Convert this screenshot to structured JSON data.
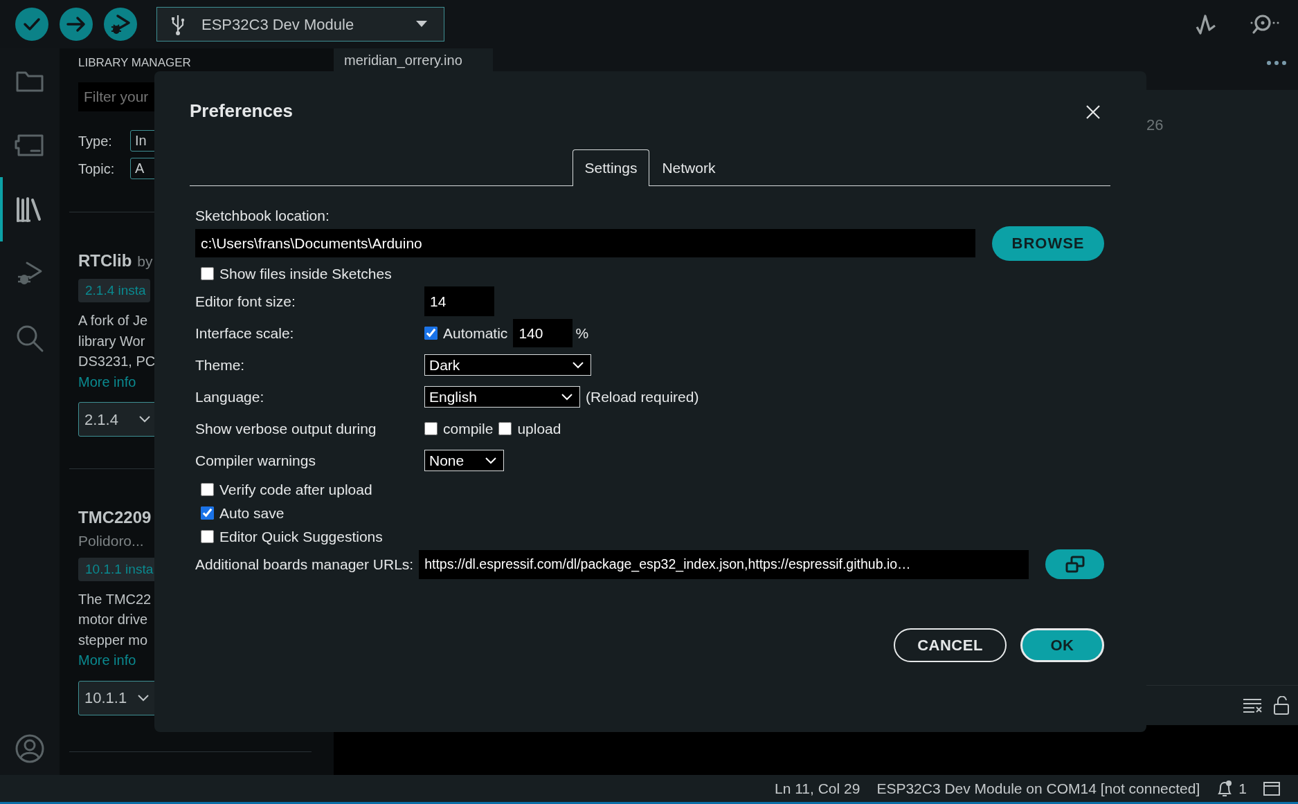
{
  "toolbar": {
    "board": "ESP32C3 Dev Module"
  },
  "activity_bar": [
    {
      "kind": "folder",
      "selected": false
    },
    {
      "kind": "board",
      "selected": false
    },
    {
      "kind": "library",
      "selected": true
    },
    {
      "kind": "debug",
      "selected": false
    },
    {
      "kind": "search",
      "selected": false
    }
  ],
  "library_manager": {
    "title": "LIBRARY MANAGER",
    "filter": {
      "placeholder": "Filter your"
    },
    "filters": [
      {
        "label": "Type:",
        "value": "In"
      },
      {
        "label": "Topic:",
        "value": "A"
      }
    ],
    "libraries": [
      {
        "name": "RTClib",
        "author": "by",
        "installed": "2.1.4 insta",
        "description": [
          "A fork of Je",
          "library Wor",
          "DS3231, PC"
        ],
        "link": "More info",
        "version": "2.1.4"
      },
      {
        "name": "TMC2209",
        "author": "Polidoro...",
        "installed": "10.1.1 insta",
        "description": [
          "The TMC22",
          "motor drive",
          "stepper mo"
        ],
        "link": "More info",
        "version": "10.1.1"
      }
    ]
  },
  "editor": {
    "tab": "meridian_orrery.ino",
    "line_number": "26"
  },
  "dialog": {
    "title": "Preferences",
    "tabs": [
      {
        "label": "Settings",
        "selected": true
      },
      {
        "label": "Network",
        "selected": false
      }
    ],
    "sketchbook": {
      "label": "Sketchbook location:",
      "value": "c:\\Users\\frans\\Documents\\Arduino",
      "button": "BROWSE"
    },
    "show_files": {
      "label": "Show files inside Sketches",
      "checked": false
    },
    "font_size": {
      "label": "Editor font size:",
      "value": "14"
    },
    "interface_scale": {
      "label": "Interface scale:",
      "automatic": {
        "label": "Automatic",
        "checked": true
      },
      "value": "140",
      "unit": "%"
    },
    "theme": {
      "label": "Theme:",
      "value": "Dark"
    },
    "language": {
      "label": "Language:",
      "value": "English",
      "note": "(Reload required)"
    },
    "verbose": {
      "label": "Show verbose output during",
      "options": [
        {
          "label": "compile",
          "checked": false
        },
        {
          "label": "upload",
          "checked": false
        }
      ]
    },
    "compiler_warnings": {
      "label": "Compiler warnings",
      "value": "None"
    },
    "options": [
      {
        "label": "Verify code after upload",
        "checked": false
      },
      {
        "label": "Auto save",
        "checked": true
      },
      {
        "label": "Editor Quick Suggestions",
        "checked": false
      }
    ],
    "boards_urls": {
      "label": "Additional boards manager URLs:",
      "value": "https://dl.espressif.com/dl/package_esp32_index.json,https://espressif.github.io…"
    },
    "buttons": [
      {
        "label": "CANCEL",
        "kind": "secondary"
      },
      {
        "label": "OK",
        "kind": "primary"
      }
    ]
  },
  "status_bar": {
    "position": "Ln 11, Col 29",
    "board": "ESP32C3 Dev Module on COM14 [not connected]",
    "notifications": "1"
  }
}
